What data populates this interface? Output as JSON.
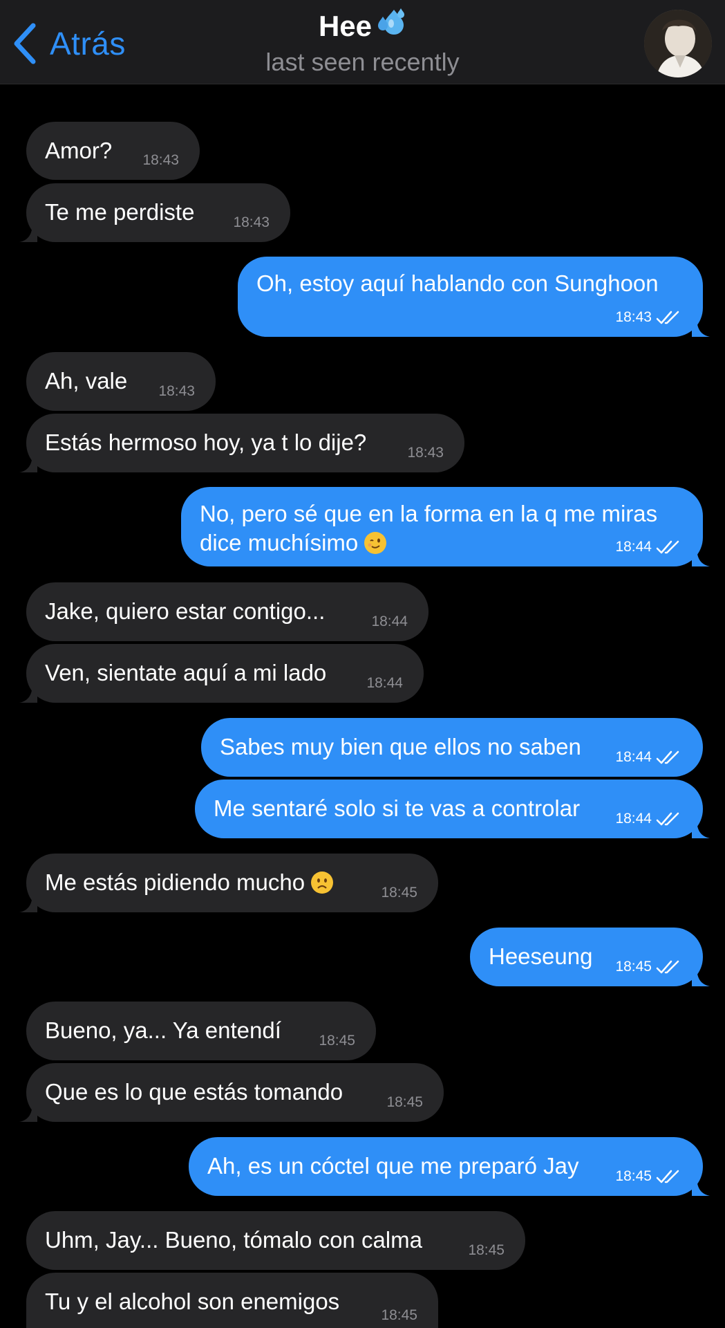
{
  "header": {
    "back_label": "Atrás",
    "title": "Hee",
    "title_icon": "droplets-icon",
    "subtitle": "last seen recently"
  },
  "colors": {
    "accent": "#2f8ff7",
    "incoming_bubble": "#262628",
    "outgoing_bubble": "#2f8ff7",
    "header_bg": "#1c1c1e",
    "timestamp": "#8e8e93"
  },
  "messages": [
    {
      "dir": "in",
      "text": "Amor?",
      "time": "18:43"
    },
    {
      "dir": "in",
      "text": "Te me perdiste",
      "time": "18:43"
    },
    {
      "dir": "out",
      "text": "Oh, estoy aquí hablando con Sunghoon",
      "time": "18:43",
      "read": true
    },
    {
      "dir": "in",
      "text": "Ah, vale",
      "time": "18:43"
    },
    {
      "dir": "in",
      "text": "Estás hermoso hoy, ya t lo dije?",
      "time": "18:43"
    },
    {
      "dir": "out",
      "text": "No, pero sé que en la forma en la q me miras",
      "text2": "dice muchísimo",
      "emoji": "winking-face-icon",
      "time": "18:44",
      "read": true
    },
    {
      "dir": "in",
      "text": "Jake, quiero estar contigo...",
      "time": "18:44"
    },
    {
      "dir": "in",
      "text": "Ven, sientate aquí a mi lado",
      "time": "18:44"
    },
    {
      "dir": "out",
      "text": "Sabes muy bien que ellos no saben",
      "time": "18:44",
      "read": true
    },
    {
      "dir": "out",
      "text": "Me sentaré solo si te vas a controlar",
      "time": "18:44",
      "read": true
    },
    {
      "dir": "in",
      "text": "Me estás pidiendo mucho",
      "emoji": "frowning-face-icon",
      "time": "18:45"
    },
    {
      "dir": "out",
      "text": "Heeseung",
      "time": "18:45",
      "read": true
    },
    {
      "dir": "in",
      "text": "Bueno, ya... Ya entendí",
      "time": "18:45"
    },
    {
      "dir": "in",
      "text": "Que es lo que estás tomando",
      "time": "18:45"
    },
    {
      "dir": "out",
      "text": "Ah, es un cóctel que me preparó Jay",
      "time": "18:45",
      "read": true
    },
    {
      "dir": "in",
      "text": "Uhm, Jay... Bueno, tómalo con calma",
      "time": "18:45"
    },
    {
      "dir": "in",
      "text": "Tu y el alcohol son enemigos",
      "time": "18:45"
    }
  ]
}
